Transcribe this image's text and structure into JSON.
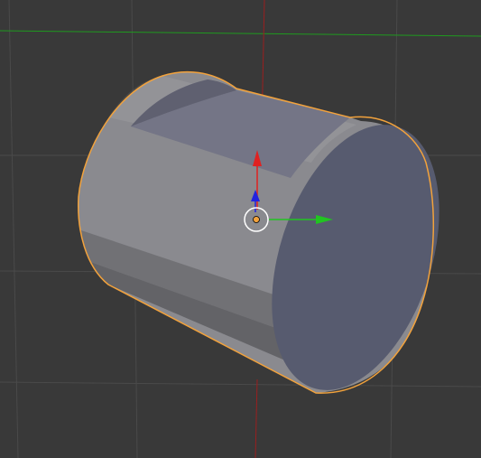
{
  "viewport": {
    "view": "3d-viewport",
    "background_color": "#393939",
    "grid_color": "#4a4a4a",
    "x_axis_line_color": "#1f9a1f",
    "z_axis_line_color": "#9a1f1f",
    "selection_outline_color": "#f2a23c"
  },
  "object": {
    "shape": "cylinder-with-flat-cut",
    "selected": true,
    "side_color": "#8a8a8f",
    "cap_color": "#575b6f",
    "cut_face_color": "#747586"
  },
  "gizmo": {
    "type": "translate-gizmo",
    "x_arrow_color": "#21c421",
    "y_arrow_color": "#2323e0",
    "z_arrow_color": "#e02121",
    "pivot_color": "#f2a23c",
    "ring_color": "#ffffff"
  }
}
